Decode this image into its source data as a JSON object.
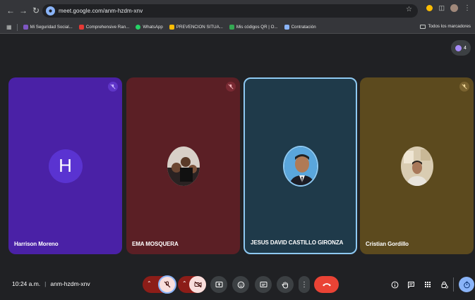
{
  "browser": {
    "url": "meet.google.com/anm-hzdm-xnv",
    "bookmarks": [
      {
        "label": "Mi Seguridad Social...",
        "color": "#7e57c2"
      },
      {
        "label": "Comprehensive Ran...",
        "color": "#e53935"
      },
      {
        "label": "WhatsApp",
        "color": "#25d366"
      },
      {
        "label": "PREVENCION SITUA...",
        "color": "#fbbc04"
      },
      {
        "label": "Mis códigos QR | O...",
        "color": "#34a853"
      },
      {
        "label": "Contratación",
        "color": "#8ab4f8"
      }
    ],
    "all_bookmarks": "Todos los marcadores"
  },
  "meet": {
    "participants_count": "4",
    "tiles": [
      {
        "name": "Harrison Moreno",
        "initial": "H",
        "bg": "#4a21a6",
        "border": "none",
        "mic_color": "#8e5cf7",
        "avatar": "letter"
      },
      {
        "name": "EMA MOSQUERA",
        "bg": "#5b1f25",
        "border": "none",
        "mic_color": "#b3404d",
        "avatar": "photo-group"
      },
      {
        "name": "JESUS DAVID CASTILLO GIRONZA",
        "bg": "#1f3a4a",
        "border": "#8ec9f2",
        "mic_color": "",
        "avatar": "photo-man"
      },
      {
        "name": "Cristian Gordillo",
        "bg": "#5c4a1e",
        "border": "none",
        "mic_color": "#8b7032",
        "avatar": "photo-room"
      }
    ],
    "time": "10:24 a.m.",
    "meeting_code": "anm-hzdm-xnv"
  },
  "colors": {
    "danger": "#8c1d18",
    "danger_light": "#f9dedc",
    "end_call": "#ea4335",
    "control_bg": "#3c4043",
    "accent": "#8ab4f8"
  }
}
